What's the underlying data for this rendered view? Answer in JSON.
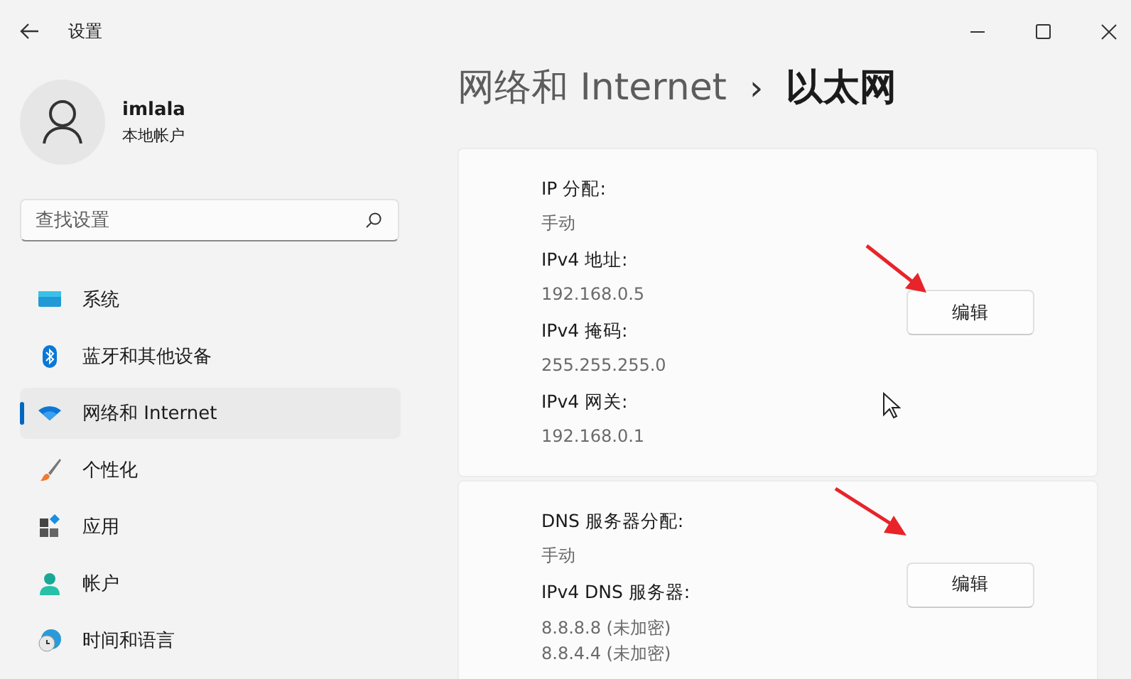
{
  "window": {
    "title": "设置"
  },
  "account": {
    "name": "imlala",
    "type": "本地帐户"
  },
  "search": {
    "placeholder": "查找设置"
  },
  "sidebar": {
    "items": [
      {
        "label": "系统",
        "kind": "system",
        "selected": false
      },
      {
        "label": "蓝牙和其他设备",
        "kind": "bluetooth",
        "selected": false
      },
      {
        "label": "网络和 Internet",
        "kind": "network",
        "selected": true
      },
      {
        "label": "个性化",
        "kind": "brush",
        "selected": false
      },
      {
        "label": "应用",
        "kind": "apps",
        "selected": false
      },
      {
        "label": "帐户",
        "kind": "account",
        "selected": false
      },
      {
        "label": "时间和语言",
        "kind": "time",
        "selected": false
      }
    ]
  },
  "breadcrumb": {
    "parent": "网络和 Internet",
    "separator": "›",
    "current": "以太网"
  },
  "sections": [
    {
      "fields": [
        {
          "label": "IP 分配:",
          "values": [
            "手动"
          ]
        },
        {
          "label": "IPv4 地址:",
          "values": [
            "192.168.0.5"
          ]
        },
        {
          "label": "IPv4 掩码:",
          "values": [
            "255.255.255.0"
          ]
        },
        {
          "label": "IPv4 网关:",
          "values": [
            "192.168.0.1"
          ]
        }
      ],
      "button": "编辑"
    },
    {
      "fields": [
        {
          "label": "DNS 服务器分配:",
          "values": [
            "手动"
          ]
        },
        {
          "label": "IPv4 DNS 服务器:",
          "values": [
            "8.8.8.8 (未加密)",
            "8.8.4.4 (未加密)"
          ]
        }
      ],
      "button": "编辑"
    }
  ]
}
